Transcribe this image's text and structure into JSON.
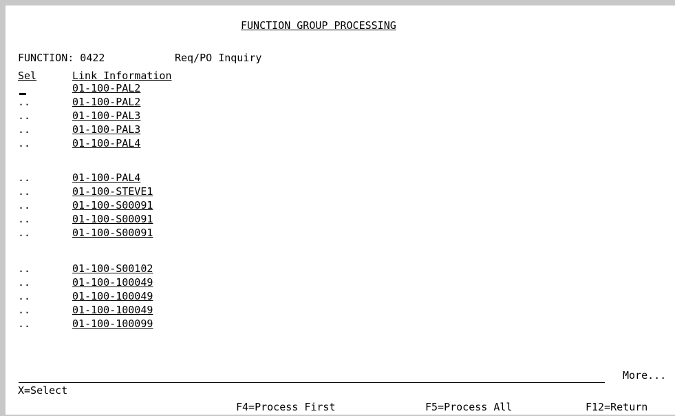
{
  "screen": {
    "title": "FUNCTION GROUP PROCESSING",
    "function_label": "FUNCTION: 0422",
    "function_desc": "Req/PO Inquiry"
  },
  "columns": {
    "sel": "Sel",
    "link_info": "Link Information"
  },
  "rows": [
    {
      "sel": "",
      "link": "01-100-PAL2"
    },
    {
      "sel": "..",
      "link": "01-100-PAL2"
    },
    {
      "sel": "..",
      "link": "01-100-PAL3"
    },
    {
      "sel": "..",
      "link": "01-100-PAL3"
    },
    {
      "sel": "..",
      "link": "01-100-PAL4"
    },
    {
      "sel": "..",
      "link": "01-100-PAL4"
    },
    {
      "sel": "..",
      "link": "01-100-STEVE1"
    },
    {
      "sel": "..",
      "link": "01-100-S00091"
    },
    {
      "sel": "..",
      "link": "01-100-S00091"
    },
    {
      "sel": "..",
      "link": "01-100-S00091"
    },
    {
      "sel": "..",
      "link": "01-100-S00102"
    },
    {
      "sel": "..",
      "link": "01-100-100049"
    },
    {
      "sel": "..",
      "link": "01-100-100049"
    },
    {
      "sel": "..",
      "link": "01-100-100049"
    },
    {
      "sel": "..",
      "link": "01-100-100099"
    }
  ],
  "more_indicator": "More...",
  "function_keys": {
    "select": "X=Select",
    "f4": "F4=Process First",
    "f5": "F5=Process All",
    "f12": "F12=Return"
  }
}
